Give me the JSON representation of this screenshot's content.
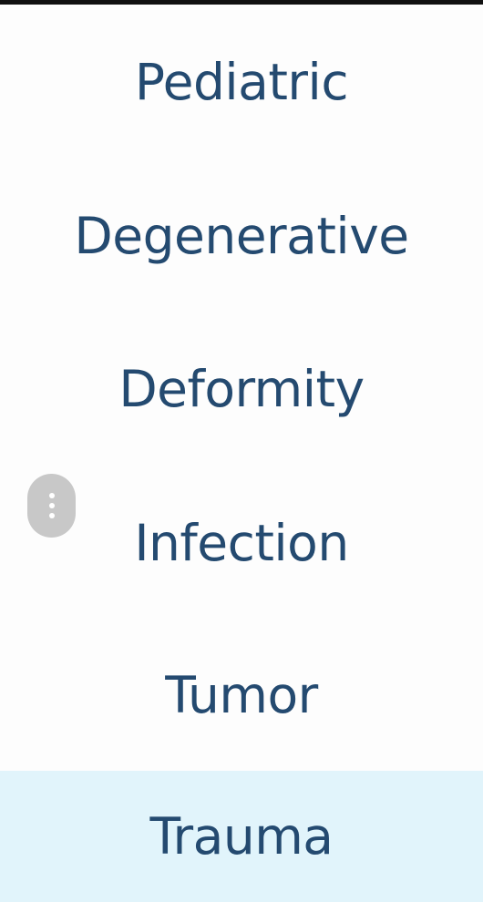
{
  "menu": {
    "items": [
      {
        "label": "Pediatric"
      },
      {
        "label": "Degenerative"
      },
      {
        "label": "Deformity"
      },
      {
        "label": "Infection"
      },
      {
        "label": "Tumor"
      },
      {
        "label": "Trauma"
      }
    ],
    "selected_label": "Trauma"
  },
  "overflow_button": {
    "icon": "more-vertical-icon"
  },
  "colors": {
    "item_text": "#244a70",
    "item_background": "#fdfdfd",
    "selected_background": "#e1f4fb",
    "overflow_button_background": "#c8c8c8"
  }
}
